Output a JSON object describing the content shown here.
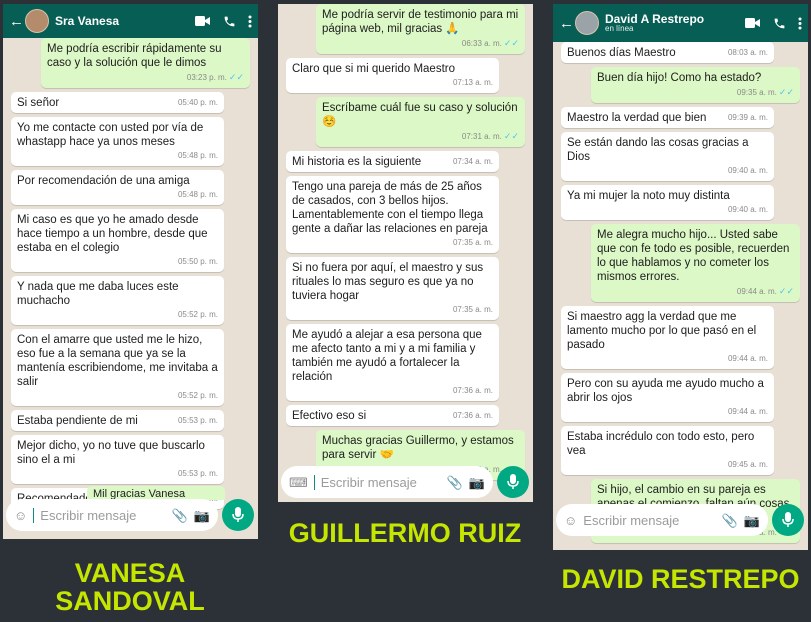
{
  "chats": [
    {
      "contact": "Sra Vanesa",
      "status": "",
      "messages": [
        {
          "dir": "out",
          "text": "Me podría escribir rápidamente su caso y la solución que le dimos",
          "time": "03:23 p. m.",
          "ticks": true
        },
        {
          "dir": "in",
          "text": "Si señor",
          "time": "05:40 p. m.",
          "inline": true
        },
        {
          "dir": "in",
          "text": "Yo me contacte con usted por vía de whastapp hace ya unos meses",
          "time": "05:48 p. m."
        },
        {
          "dir": "in",
          "text": "Por recomendación de una amiga",
          "time": "05:48 p. m."
        },
        {
          "dir": "in",
          "text": "Mi caso es que yo he amado desde hace tiempo a un hombre, desde que estaba en el colegio",
          "time": "05:50 p. m."
        },
        {
          "dir": "in",
          "text": "Y nada que me daba luces este muchacho",
          "time": "05:52 p. m."
        },
        {
          "dir": "in",
          "text": "Con el amarre que usted me le hizo, eso fue a la semana que ya se la mantenía escribiendome, me invitaba a salir",
          "time": "05:52 p. m."
        },
        {
          "dir": "in",
          "text": "Estaba pendiente de mi",
          "time": "05:53 p. m.",
          "inline": true
        },
        {
          "dir": "in",
          "text": "Mejor dicho, yo no tuve que buscarlo sino el a mi",
          "time": "05:53 p. m."
        },
        {
          "dir": "in",
          "text": "Recomendado al 💯💯",
          "time": "05:53 p. m.",
          "inline": true
        }
      ],
      "partial": "Mil gracias Vanesa",
      "input_placeholder": "Escribir mensaje"
    },
    {
      "contact": "",
      "status": "",
      "messages": [
        {
          "dir": "out",
          "text": "Me podría servir de testimonio para mi página web, mil gracias 🙏",
          "time": "06:33 a. m.",
          "ticks": true
        },
        {
          "dir": "in",
          "text": "Claro que si mi querido Maestro",
          "time": "07:13 a. m."
        },
        {
          "dir": "out",
          "text": "Escríbame cuál fue su caso y solución ☺️",
          "time": "07:31 a. m.",
          "ticks": true
        },
        {
          "dir": "in",
          "text": "Mi historia es la siguiente",
          "time": "07:34 a. m.",
          "inline": true
        },
        {
          "dir": "in",
          "text": "Tengo una pareja de más de 25 años de casados, con 3 bellos hijos. Lamentablemente con el tiempo llega gente a dañar las relaciones en pareja",
          "time": "07:35 a. m."
        },
        {
          "dir": "in",
          "text": "Si no fuera por aquí, el maestro y sus rituales lo mas seguro es que ya no tuviera hogar",
          "time": "07:35 a. m."
        },
        {
          "dir": "in",
          "text": "Me ayudó a alejar a esa persona que me afecto tanto a mi y a mi familia y también me ayudó a fortalecer la relación",
          "time": "07:36 a. m."
        },
        {
          "dir": "in",
          "text": "Efectivo eso si",
          "time": "07:36 a. m.",
          "inline": true
        },
        {
          "dir": "out",
          "text": "Muchas gracias Guillermo, y estamos para servir 🤝",
          "time": "07:45 a. m.",
          "ticks": true
        }
      ],
      "input_placeholder": "Escribir mensaje"
    },
    {
      "contact": "David A Restrepo",
      "status": "en línea",
      "messages": [
        {
          "dir": "in",
          "text": "Buenos días Maestro",
          "time": "08:03 a. m.",
          "inline": true
        },
        {
          "dir": "out",
          "text": "Buen día hijo! Como ha estado?",
          "time": "09:35 a. m.",
          "ticks": true
        },
        {
          "dir": "in",
          "text": "Maestro la verdad que bien",
          "time": "09:39 a. m.",
          "inline": true
        },
        {
          "dir": "in",
          "text": "Se están dando las cosas gracias a Dios",
          "time": "09:40 a. m."
        },
        {
          "dir": "in",
          "text": "Ya mi mujer la noto muy distinta",
          "time": "09:40 a. m."
        },
        {
          "dir": "out",
          "text": "Me alegra mucho hijo... Usted sabe que con fe todo es posible, recuerden lo que hablamos y no cometer los mismos errores.",
          "time": "09:44 a. m.",
          "ticks": true
        },
        {
          "dir": "in",
          "text": "Si maestro agg la verdad que me lamento mucho por lo que pasó en el pasado",
          "time": "09:44 a. m."
        },
        {
          "dir": "in",
          "text": "Pero con su ayuda me ayudo mucho a abrir los ojos",
          "time": "09:44 a. m."
        },
        {
          "dir": "in",
          "text": "Estaba incrédulo con todo esto, pero vea",
          "time": "09:45 a. m."
        },
        {
          "dir": "out",
          "text": "Si hijo, el cambio en su pareja es apenas el comienzo, faltan aún cosas por hacer, paso a paso.",
          "time": "09:52 a. m.",
          "ticks": true
        }
      ],
      "input_placeholder": "Escribir mensaje"
    }
  ],
  "captions": [
    "VANESA SANDOVAL",
    "GUILLERMO RUIZ",
    "DAVID RESTREPO"
  ],
  "colors": {
    "header": "#075e54",
    "outgoing": "#dcf8c6",
    "incoming": "#ffffff",
    "caption": "#c5e600",
    "background": "#2c3138"
  },
  "icons": {
    "video": "video-call-icon",
    "phone": "phone-icon",
    "menu": "more-vert-icon",
    "mic": "mic-icon",
    "attach": "attach-icon",
    "camera": "camera-icon",
    "emoji": "emoji-icon"
  }
}
